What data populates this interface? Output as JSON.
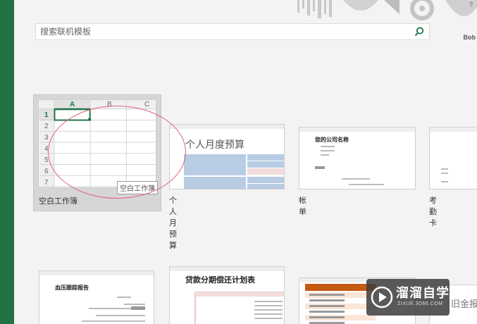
{
  "search": {
    "placeholder": "搜索联机模板"
  },
  "help": "?",
  "deco_text": "Bob",
  "templates": [
    {
      "label": "空白工作簿",
      "tooltip": "空白工作簿",
      "columns": [
        "A",
        "B",
        "C"
      ],
      "rows": [
        "1",
        "2",
        "3",
        "4",
        "5",
        "6",
        "7"
      ]
    },
    {
      "label": "个人月预算",
      "heading": "个人月度预算"
    },
    {
      "label": "帐单",
      "heading": "您的公司名称"
    },
    {
      "label": "考勤卡"
    },
    {
      "label": "",
      "heading": "血压跟踪报告"
    },
    {
      "label": "",
      "heading": "贷款分期偿还计划表"
    },
    {
      "label": ""
    },
    {
      "label": "",
      "heading": "旧金报税"
    }
  ],
  "watermark": {
    "title": "溜溜自学",
    "url": "ZIXUE.3D66.COM"
  },
  "colors": {
    "excel_green": "#217346",
    "annotation_red": "#e0607a"
  }
}
